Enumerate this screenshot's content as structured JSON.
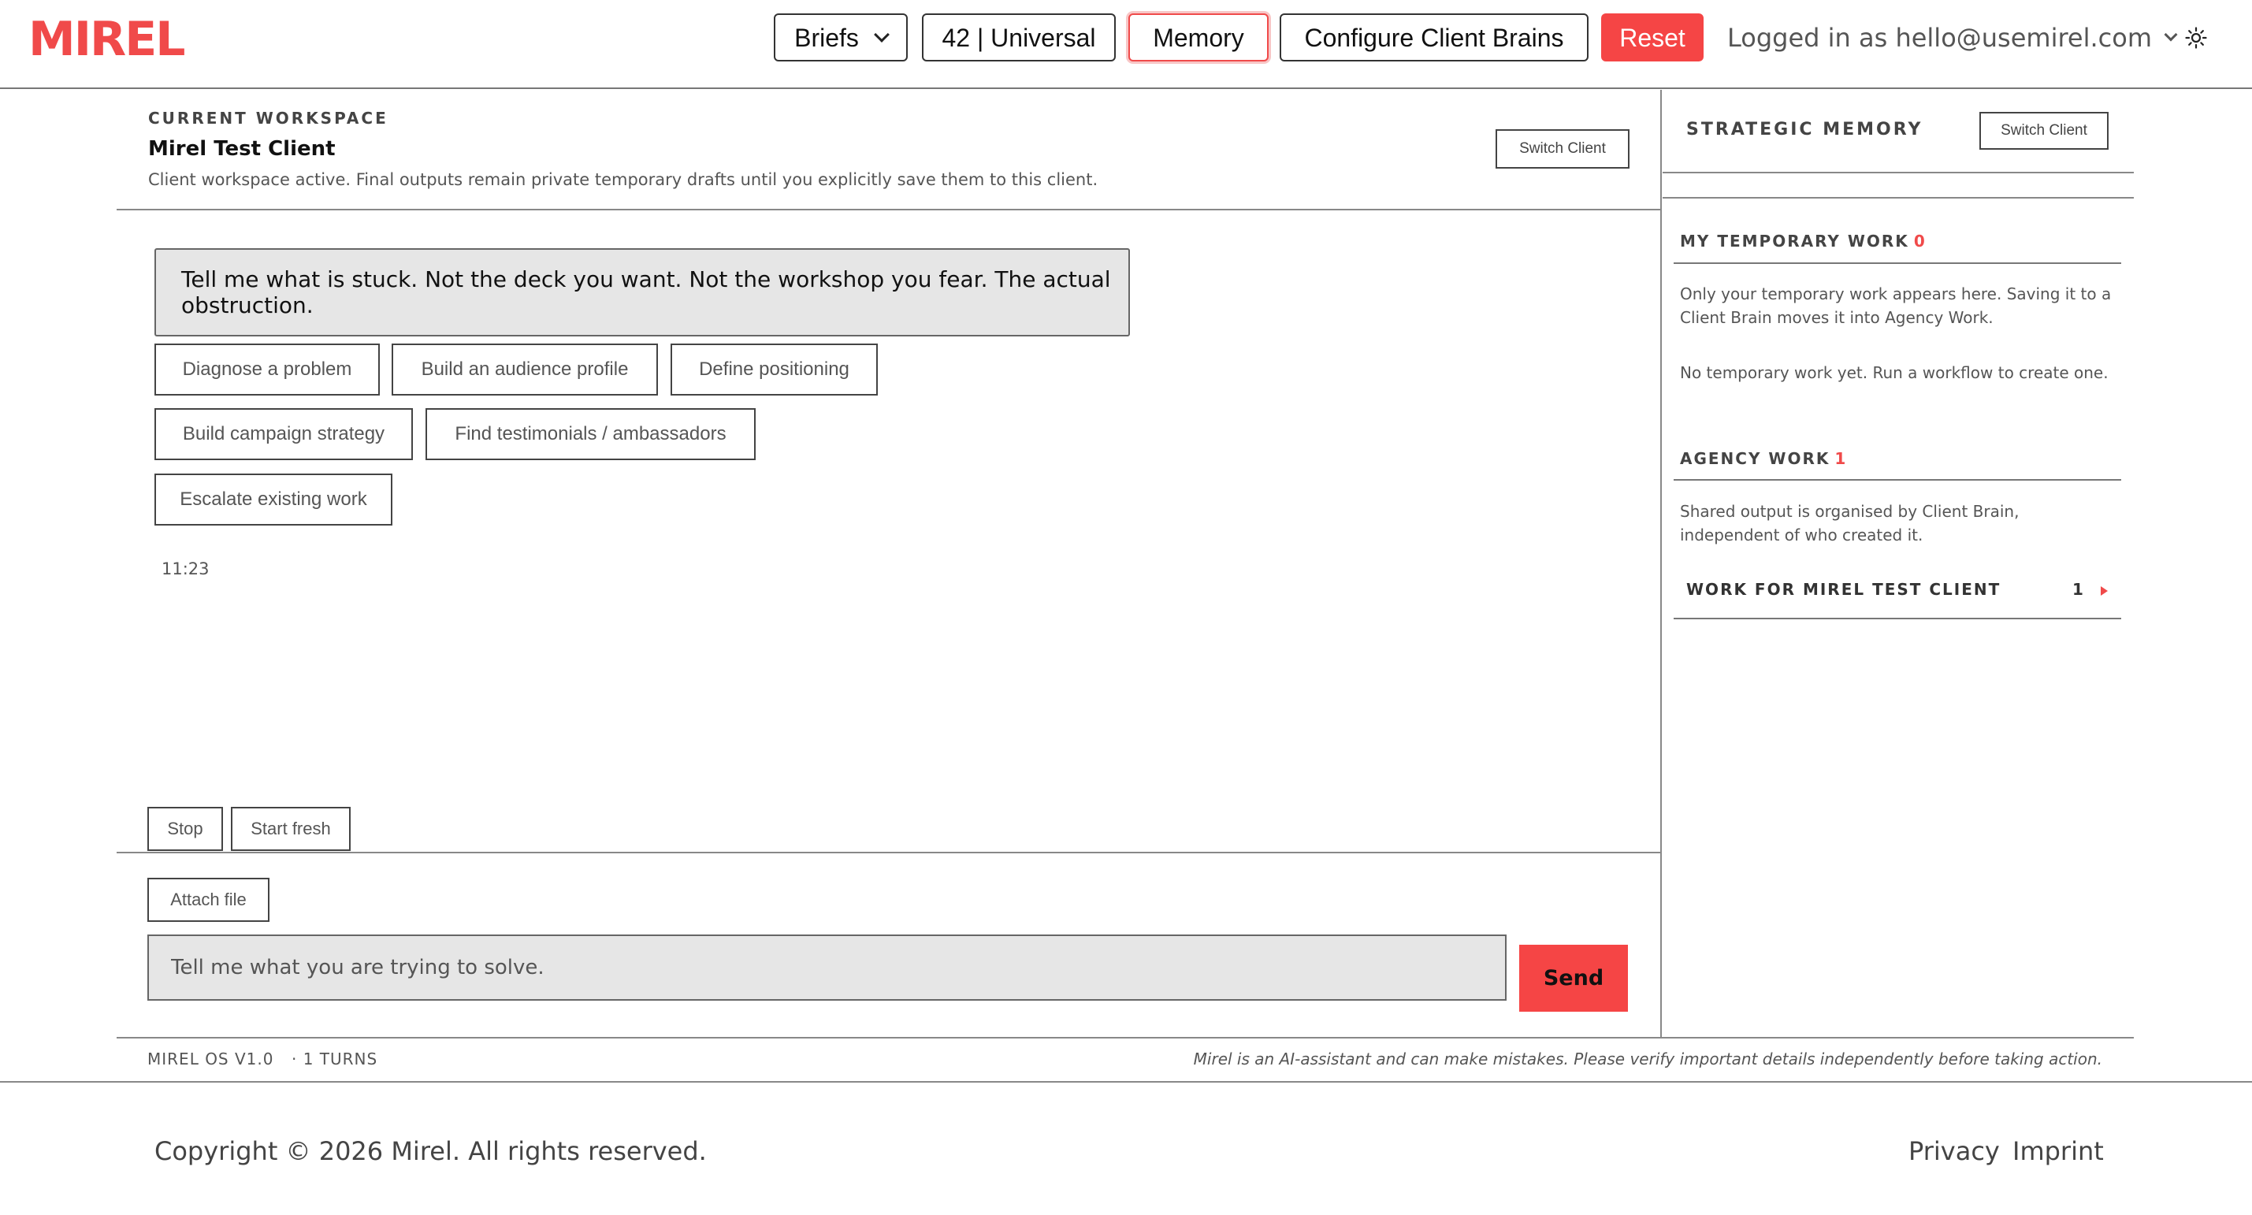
{
  "header": {
    "logo": "MIREL",
    "briefs_label": "Briefs",
    "universal_label": "42 | Universal",
    "memory_label": "Memory",
    "configure_label": "Configure Client Brains",
    "reset_label": "Reset",
    "logged_in": "Logged in as hello@usemirel.com",
    "icons": {
      "briefs_dropdown": "chevron-down-icon",
      "user_dropdown": "chevron-down-icon",
      "theme_toggle": "sun-icon"
    }
  },
  "workspace": {
    "kicker": "CURRENT WORKSPACE",
    "title": "Mirel Test Client",
    "description": "Client workspace active. Final outputs remain private temporary drafts until you explicitly save them to this client.",
    "switch_label": "Switch Client"
  },
  "chat": {
    "prompt": "Tell me what is stuck. Not the deck you want. Not the workshop you fear. The actual obstruction.",
    "chips": [
      "Diagnose a problem",
      "Build an audience profile",
      "Define positioning",
      "Build campaign strategy",
      "Find testimonials / ambassadors",
      "Escalate existing work"
    ],
    "timestamp": "11:23",
    "stop_label": "Stop",
    "fresh_label": "Start fresh",
    "attach_label": "Attach file",
    "input_placeholder": "Tell me what you are trying to solve.",
    "send_label": "Send"
  },
  "memory": {
    "title": "STRATEGIC MEMORY",
    "switch_label": "Switch Client",
    "temp_heading": "MY TEMPORARY WORK",
    "temp_count": "0",
    "temp_text": "Only your temporary work appears here. Saving it to a Client Brain moves it into Agency Work.",
    "temp_empty": "No temporary work yet. Run a workflow to create one.",
    "agency_heading": "AGENCY WORK",
    "agency_count": "1",
    "agency_text": "Shared output is organised by Client Brain, independent of who created it.",
    "work_row_label": "WORK FOR MIREL TEST CLIENT",
    "work_row_count": "1",
    "work_row_icon": "caret-right-icon"
  },
  "status": {
    "version": "MIREL OS V1.0",
    "turns": "· 1 TURNS",
    "disclaimer": "Mirel is an AI-assistant and can make mistakes. Please verify important details independently before taking action."
  },
  "footer": {
    "copyright": "Copyright © 2026 Mirel. All rights reserved.",
    "privacy": "Privacy",
    "imprint": "Imprint"
  },
  "colors": {
    "accent": "#f04a4a",
    "button_red": "#f54545",
    "input_bg": "#e6e6e6"
  }
}
